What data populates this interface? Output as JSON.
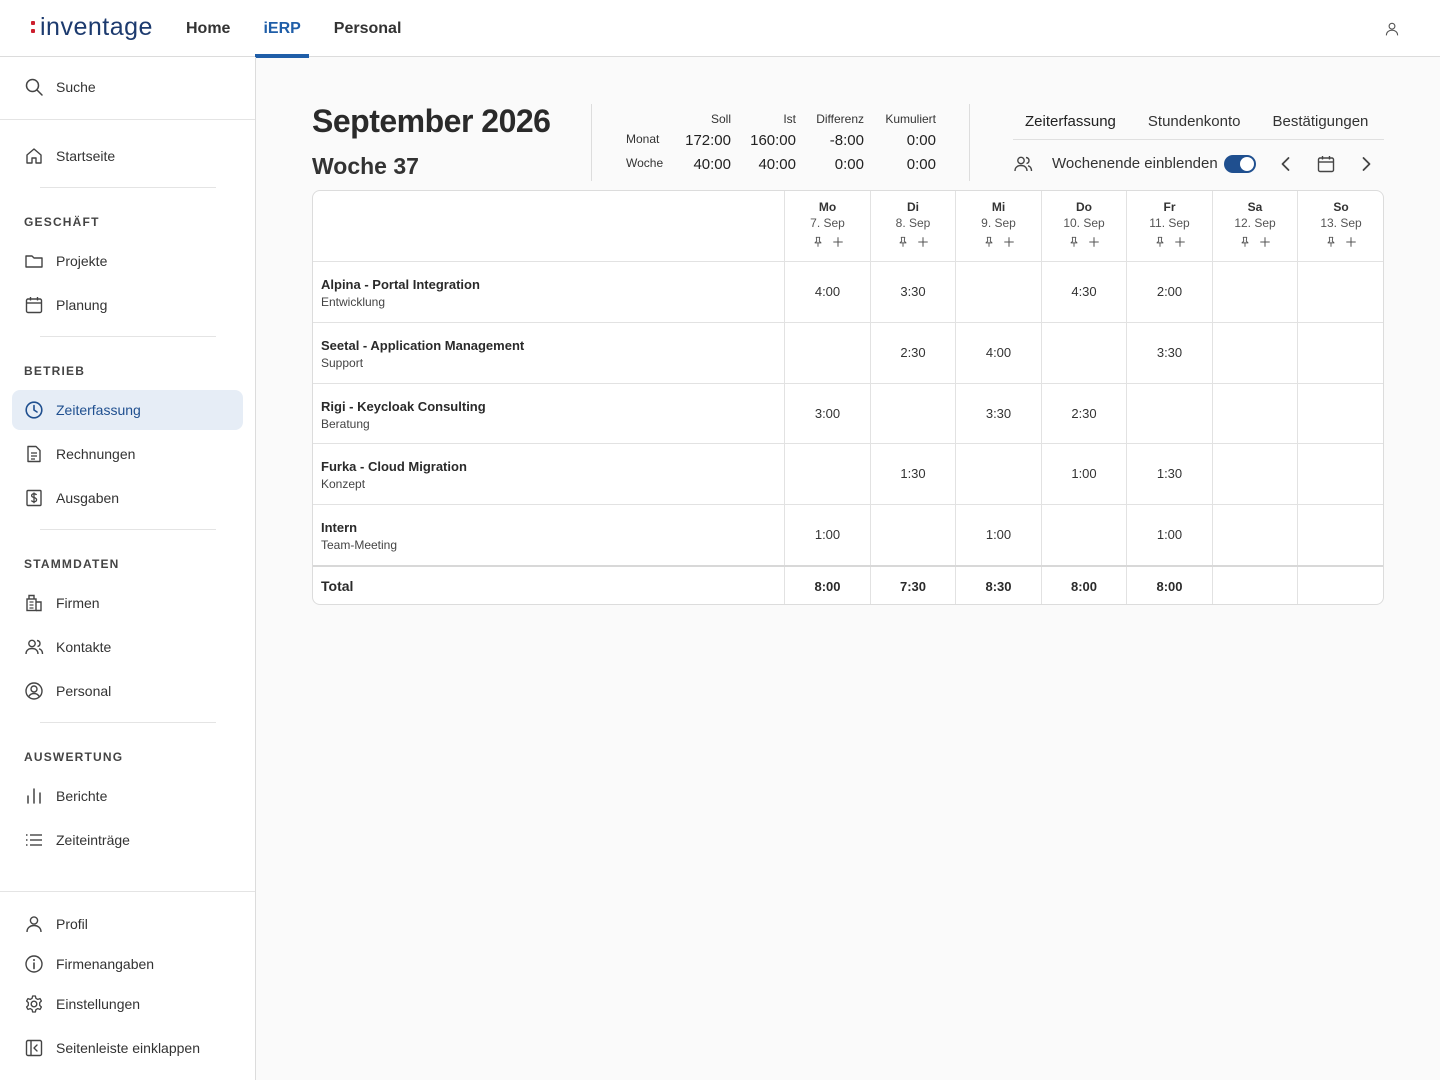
{
  "app": {
    "logo_text": "inventage"
  },
  "topnav": [
    {
      "label": "Home",
      "active": false
    },
    {
      "label": "iERP",
      "active": true
    },
    {
      "label": "Personal",
      "active": false
    }
  ],
  "sidebar": {
    "search_label": "Suche",
    "home_label": "Startseite",
    "sections": [
      {
        "title": "GESCHÄFT",
        "items": [
          {
            "label": "Projekte",
            "icon": "folder-icon"
          },
          {
            "label": "Planung",
            "icon": "calendar-icon"
          }
        ]
      },
      {
        "title": "BETRIEB",
        "items": [
          {
            "label": "Zeiterfassung",
            "icon": "clock-icon",
            "active": true
          },
          {
            "label": "Rechnungen",
            "icon": "document-icon"
          },
          {
            "label": "Ausgaben",
            "icon": "dollar-receipt-icon"
          }
        ]
      },
      {
        "title": "STAMMDATEN",
        "items": [
          {
            "label": "Firmen",
            "icon": "building-icon"
          },
          {
            "label": "Kontakte",
            "icon": "users-icon"
          },
          {
            "label": "Personal",
            "icon": "user-circle-icon"
          }
        ]
      },
      {
        "title": "AUSWERTUNG",
        "items": [
          {
            "label": "Berichte",
            "icon": "bar-chart-icon"
          },
          {
            "label": "Zeiteinträge",
            "icon": "list-icon"
          }
        ]
      }
    ],
    "footer": [
      {
        "label": "Profil",
        "icon": "user-icon"
      },
      {
        "label": "Firmenangaben",
        "icon": "info-icon"
      },
      {
        "label": "Einstellungen",
        "icon": "gear-icon"
      },
      {
        "label": "Seitenleiste einklappen",
        "icon": "collapse-sidebar-icon"
      }
    ]
  },
  "header": {
    "title": "September 2026",
    "subtitle": "Woche 37"
  },
  "stats": {
    "columns": [
      "Soll",
      "Ist",
      "Differenz",
      "Kumuliert"
    ],
    "rows": [
      {
        "label": "Monat",
        "values": [
          "172:00",
          "160:00",
          "-8:00",
          "0:00"
        ]
      },
      {
        "label": "Woche",
        "values": [
          "40:00",
          "40:00",
          "0:00",
          "0:00"
        ]
      }
    ]
  },
  "tabs": [
    {
      "label": "Zeiterfassung",
      "active": true
    },
    {
      "label": "Stundenkonto",
      "active": false
    },
    {
      "label": "Bestätigungen",
      "active": false
    }
  ],
  "controls": {
    "weekend_label": "Wochenende einblenden",
    "weekend_enabled": true
  },
  "table": {
    "days": [
      {
        "name": "Mo",
        "date": "7. Sep"
      },
      {
        "name": "Di",
        "date": "8. Sep"
      },
      {
        "name": "Mi",
        "date": "9. Sep"
      },
      {
        "name": "Do",
        "date": "10. Sep"
      },
      {
        "name": "Fr",
        "date": "11. Sep"
      },
      {
        "name": "Sa",
        "date": "12. Sep"
      },
      {
        "name": "So",
        "date": "13. Sep"
      }
    ],
    "rows": [
      {
        "project": "Alpina - Portal Integration",
        "task": "Entwicklung",
        "hours": [
          "4:00",
          "3:30",
          "",
          "4:30",
          "2:00",
          "",
          ""
        ]
      },
      {
        "project": "Seetal - Application Management",
        "task": "Support",
        "hours": [
          "",
          "2:30",
          "4:00",
          "",
          "3:30",
          "",
          ""
        ]
      },
      {
        "project": "Rigi - Keycloak Consulting",
        "task": "Beratung",
        "hours": [
          "3:00",
          "",
          "3:30",
          "2:30",
          "",
          "",
          ""
        ]
      },
      {
        "project": "Furka - Cloud Migration",
        "task": "Konzept",
        "hours": [
          "",
          "1:30",
          "",
          "1:00",
          "1:30",
          "",
          ""
        ]
      },
      {
        "project": "Intern",
        "task": "Team-Meeting",
        "hours": [
          "1:00",
          "",
          "1:00",
          "",
          "1:00",
          "",
          ""
        ]
      }
    ],
    "total_label": "Total",
    "totals": [
      "8:00",
      "7:30",
      "8:30",
      "8:00",
      "8:00",
      "",
      ""
    ]
  }
}
